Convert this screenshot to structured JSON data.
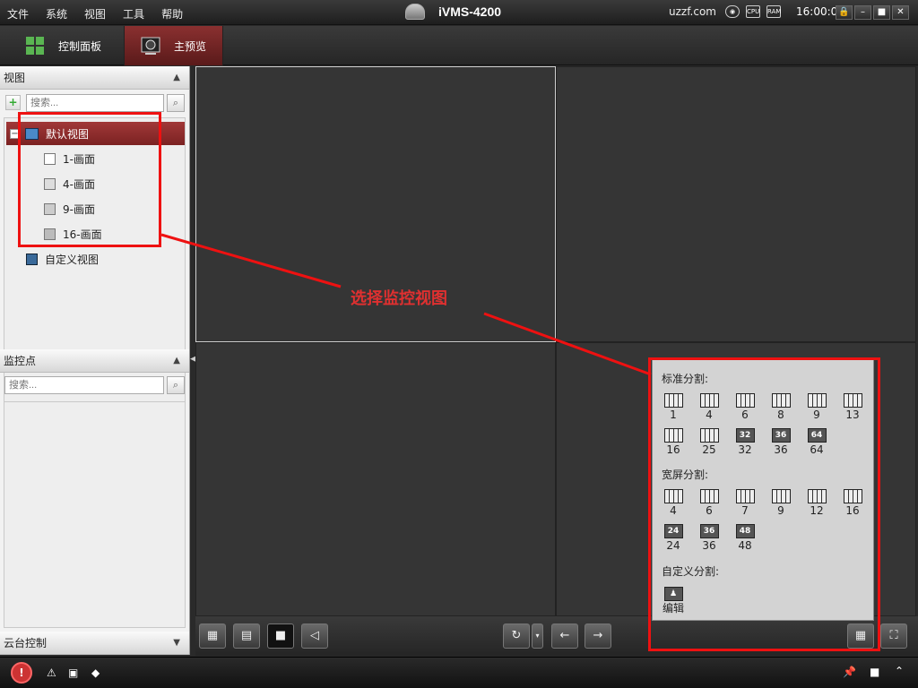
{
  "titlebar": {
    "menu": [
      "文件",
      "系统",
      "视图",
      "工具",
      "帮助"
    ],
    "app_title": "iVMS-4200",
    "site": "uzzf.com",
    "clock": "16:00:02"
  },
  "tabs": [
    {
      "label": "控制面板"
    },
    {
      "label": "主预览"
    }
  ],
  "sidebar": {
    "view_header": "视图",
    "search_placeholder": "搜索...",
    "tree": {
      "root": "默认视图",
      "items": [
        "1-画面",
        "4-画面",
        "9-画面",
        "16-画面"
      ],
      "custom": "自定义视图"
    },
    "monitor_header": "监控点",
    "monitor_search_placeholder": "搜索...",
    "ptz_header": "云台控制"
  },
  "annotation": {
    "text": "选择监控视图"
  },
  "layout_popup": {
    "standard_title": "标准分割:",
    "standard": [
      {
        "label": "1"
      },
      {
        "label": "4"
      },
      {
        "label": "6"
      },
      {
        "label": "8"
      },
      {
        "label": "9"
      },
      {
        "label": "13"
      },
      {
        "label": "16"
      },
      {
        "label": "25"
      },
      {
        "label": "32",
        "badge": "32"
      },
      {
        "label": "36",
        "badge": "36"
      },
      {
        "label": "64",
        "badge": "64"
      }
    ],
    "wide_title": "宽屏分割:",
    "wide": [
      {
        "label": "4"
      },
      {
        "label": "6"
      },
      {
        "label": "7"
      },
      {
        "label": "9"
      },
      {
        "label": "12"
      },
      {
        "label": "16"
      },
      {
        "label": "24",
        "badge": "24"
      },
      {
        "label": "36",
        "badge": "36"
      },
      {
        "label": "48",
        "badge": "48"
      }
    ],
    "custom_title": "自定义分割:",
    "edit_label": "编辑"
  },
  "colors": {
    "accent": "#8a2a2a",
    "highlight": "#ee1111",
    "annotation_text": "#e03030"
  }
}
